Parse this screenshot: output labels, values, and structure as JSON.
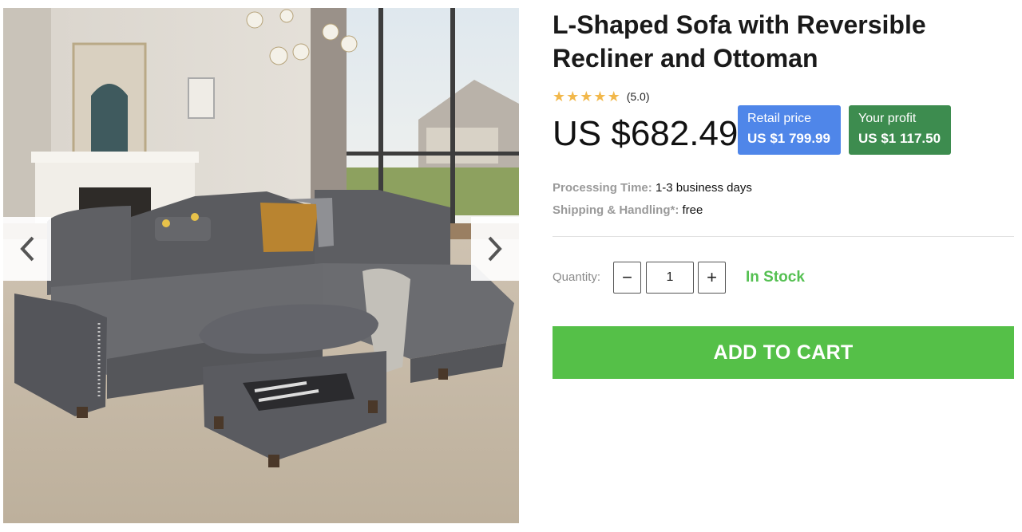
{
  "product": {
    "title": "L-Shaped Sofa with Reversible Recliner and Ottoman",
    "rating_stars": 5,
    "rating_text": "(5.0)",
    "price": "US $682.49"
  },
  "retail": {
    "label": "Retail price",
    "value": "US $1 799.99",
    "color": "#4f86e9"
  },
  "profit": {
    "label": "Your profit",
    "value": "US $1 117.50",
    "color": "#3d8c4f"
  },
  "processing": {
    "label": "Processing Time:",
    "value": "1-3 business days"
  },
  "shipping": {
    "label": "Shipping & Handling*:",
    "value": "free"
  },
  "quantity": {
    "label": "Quantity:",
    "value": "1",
    "minus": "−",
    "plus": "+"
  },
  "stock": {
    "text": "In Stock",
    "color": "#55c052"
  },
  "cart": {
    "label": "ADD TO CART",
    "color": "#55c048"
  },
  "gallery": {
    "prev_icon": "chevron-left-icon",
    "next_icon": "chevron-right-icon"
  }
}
